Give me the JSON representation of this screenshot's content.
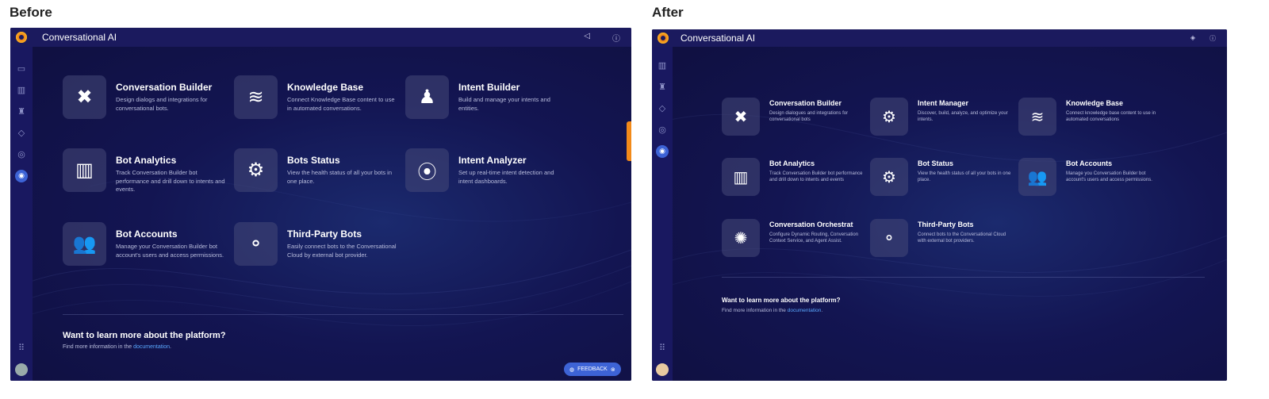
{
  "labels": {
    "before": "Before",
    "after": "After"
  },
  "before": {
    "app_title": "Conversational AI",
    "cards": [
      {
        "title": "Conversation Builder",
        "desc": "Design dialogs and integrations for conversational bots.",
        "icon": "chat-gear-icon",
        "glyph": "✖"
      },
      {
        "title": "Knowledge Base",
        "desc": "Connect Knowledge Base content to use in automated conversations.",
        "icon": "database-icon",
        "glyph": "≋"
      },
      {
        "title": "Intent Builder",
        "desc": "Build and manage your intents and entities.",
        "icon": "intent-builder-icon",
        "glyph": "♟"
      },
      {
        "title": "Bot Analytics",
        "desc": "Track Conversation Builder bot performance and drill down to intents and events.",
        "icon": "bar-chart-icon",
        "glyph": "▥"
      },
      {
        "title": "Bots Status",
        "desc": "View the health status of all your bots in one place.",
        "icon": "gears-icon",
        "glyph": "⚙"
      },
      {
        "title": "Intent Analyzer",
        "desc": "Set up real-time intent detection and intent dashboards.",
        "icon": "signal-chart-icon",
        "glyph": "⦿"
      },
      {
        "title": "Bot Accounts",
        "desc": "Manage your Conversation Builder bot account's users and access permissions.",
        "icon": "users-icon",
        "glyph": "👥"
      },
      {
        "title": "Third-Party Bots",
        "desc": "Easily connect bots to the Conversational Cloud by external bot provider.",
        "icon": "network-icon",
        "glyph": "⚬"
      }
    ],
    "learn_title": "Want to learn more about the platform?",
    "learn_prefix": "Find more information in the ",
    "learn_link": "documentation",
    "learn_suffix": ".",
    "feedback": "FEEDBACK"
  },
  "after": {
    "app_title": "Conversational AI",
    "cards": [
      {
        "title": "Conversation Builder",
        "desc": "Design dialogues and integrations for conversational bots",
        "icon": "chat-gear-icon",
        "glyph": "✖"
      },
      {
        "title": "Intent Manager",
        "desc": "Discover, build, analyze, and optimize your intents.",
        "icon": "intent-manager-icon",
        "glyph": "⚙"
      },
      {
        "title": "Knowledge Base",
        "desc": "Connect knowledge base content to use in automated conversations",
        "icon": "database-icon",
        "glyph": "≋"
      },
      {
        "title": "Bot Analytics",
        "desc": "Track Conversation Builder bot performance and drill down to intents and events",
        "icon": "bar-chart-icon",
        "glyph": "▥"
      },
      {
        "title": "Bot Status",
        "desc": "View the health status of all your bots in one place.",
        "icon": "gears-icon",
        "glyph": "⚙"
      },
      {
        "title": "Bot Accounts",
        "desc": "Manage you Conversation Builder bot account's users and access permissions.",
        "icon": "users-icon",
        "glyph": "👥"
      },
      {
        "title": "Conversation Orchestrat",
        "desc": "Configure Dynamic Routing, Conversation Context Service, and Agent Assist.",
        "icon": "brain-icon",
        "glyph": "✺"
      },
      {
        "title": "Third-Party Bots",
        "desc": "Connect bots to the Conversational Cloud with external bot providers.",
        "icon": "network-icon",
        "glyph": "⚬"
      }
    ],
    "learn_title": "Want to learn more about the platform?",
    "learn_prefix": "Find more information in the ",
    "learn_link": "documentation",
    "learn_suffix": "."
  }
}
